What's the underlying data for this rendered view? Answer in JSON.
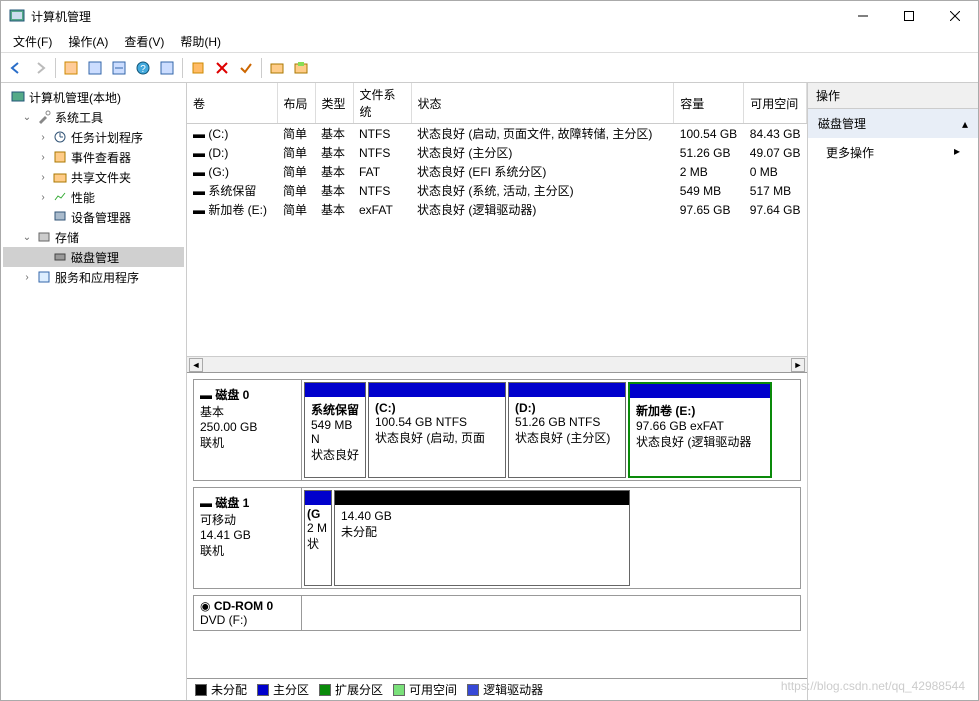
{
  "window": {
    "title": "计算机管理"
  },
  "menus": [
    "文件(F)",
    "操作(A)",
    "查看(V)",
    "帮助(H)"
  ],
  "tree": {
    "root": "计算机管理(本地)",
    "sys_tools": "系统工具",
    "task_sched": "任务计划程序",
    "event_viewer": "事件查看器",
    "shared": "共享文件夹",
    "perf": "性能",
    "devmgr": "设备管理器",
    "storage": "存储",
    "disk_mgmt": "磁盘管理",
    "svc": "服务和应用程序"
  },
  "columns": {
    "vol": "卷",
    "layout": "布局",
    "type": "类型",
    "fs": "文件系统",
    "status": "状态",
    "capacity": "容量",
    "free": "可用空间"
  },
  "volumes": [
    {
      "name": "(C:)",
      "layout": "简单",
      "type": "基本",
      "fs": "NTFS",
      "status": "状态良好 (启动, 页面文件, 故障转储, 主分区)",
      "capacity": "100.54 GB",
      "free": "84.43 GB"
    },
    {
      "name": "(D:)",
      "layout": "简单",
      "type": "基本",
      "fs": "NTFS",
      "status": "状态良好 (主分区)",
      "capacity": "51.26 GB",
      "free": "49.07 GB"
    },
    {
      "name": "(G:)",
      "layout": "简单",
      "type": "基本",
      "fs": "FAT",
      "status": "状态良好 (EFI 系统分区)",
      "capacity": "2 MB",
      "free": "0 MB"
    },
    {
      "name": "系统保留",
      "layout": "简单",
      "type": "基本",
      "fs": "NTFS",
      "status": "状态良好 (系统, 活动, 主分区)",
      "capacity": "549 MB",
      "free": "517 MB"
    },
    {
      "name": "新加卷 (E:)",
      "layout": "简单",
      "type": "基本",
      "fs": "exFAT",
      "status": "状态良好 (逻辑驱动器)",
      "capacity": "97.65 GB",
      "free": "97.64 GB"
    }
  ],
  "disk0": {
    "label": "磁盘 0",
    "type": "基本",
    "size": "250.00 GB",
    "state": "联机",
    "parts": [
      {
        "name": "系统保留",
        "info": "549 MB N",
        "status": "状态良好"
      },
      {
        "name": "(C:)",
        "info": "100.54 GB NTFS",
        "status": "状态良好 (启动, 页面"
      },
      {
        "name": "(D:)",
        "info": "51.26 GB NTFS",
        "status": "状态良好 (主分区)"
      },
      {
        "name": "新加卷   (E:)",
        "info": "97.66 GB exFAT",
        "status": "状态良好 (逻辑驱动器"
      }
    ]
  },
  "disk1": {
    "label": "磁盘 1",
    "type": "可移动",
    "size": "14.41 GB",
    "state": "联机",
    "parts": [
      {
        "name": "(G",
        "info": "2 M",
        "status": "状"
      },
      {
        "name": "",
        "info": "14.40 GB",
        "status": "未分配"
      }
    ]
  },
  "cdrom": {
    "label": "CD-ROM 0",
    "type": "DVD (F:)"
  },
  "legend": {
    "unalloc": "未分配",
    "primary": "主分区",
    "ext": "扩展分区",
    "free": "可用空间",
    "logical": "逻辑驱动器"
  },
  "actions": {
    "head": "操作",
    "disk_mgmt": "磁盘管理",
    "more": "更多操作"
  },
  "watermark": "https://blog.csdn.net/qq_42988544"
}
